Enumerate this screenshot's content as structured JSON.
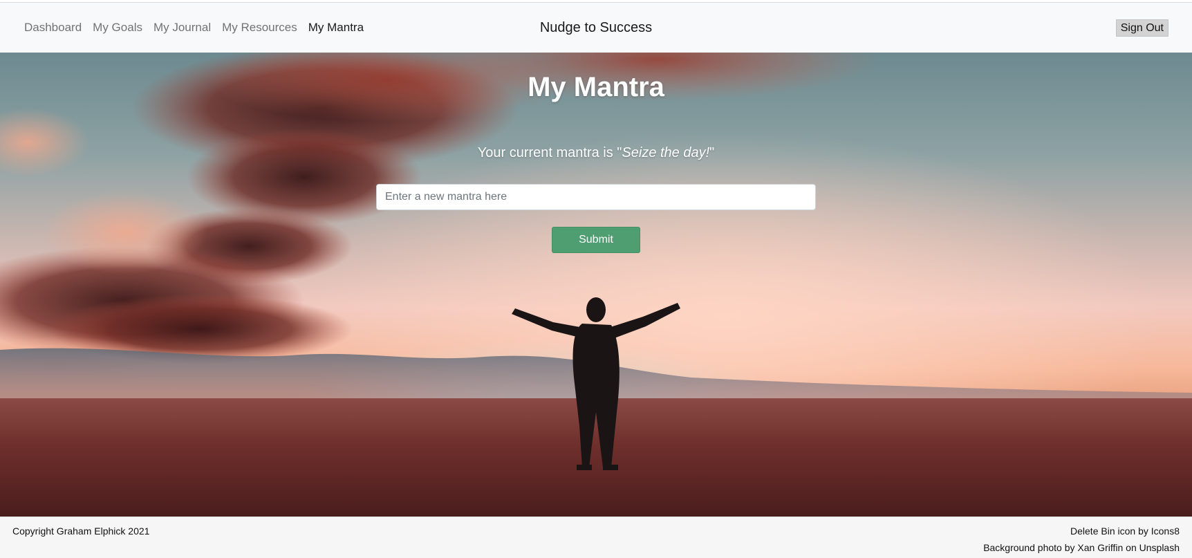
{
  "nav": {
    "links": [
      {
        "label": "Dashboard"
      },
      {
        "label": "My Goals"
      },
      {
        "label": "My Journal"
      },
      {
        "label": "My Resources"
      },
      {
        "label": "My Mantra",
        "active": true
      }
    ],
    "brand": "Nudge to Success",
    "signout_label": "Sign Out"
  },
  "main": {
    "title": "My Mantra",
    "current_prefix": "Your current mantra is \"",
    "current_mantra": "Seize the day!",
    "current_suffix": "\"",
    "input_placeholder": "Enter a new mantra here",
    "input_value": "",
    "submit_label": "Submit"
  },
  "footer": {
    "copyright": "Copyright Graham Elphick 2021",
    "credit_icon": "Delete Bin icon by Icons8",
    "credit_photo": "Background photo by Xan Griffin on Unsplash"
  },
  "colors": {
    "navbar_bg": "#f8f9fa",
    "submit_bg": "#4f9e72",
    "signout_bg": "#d3d3d3"
  }
}
